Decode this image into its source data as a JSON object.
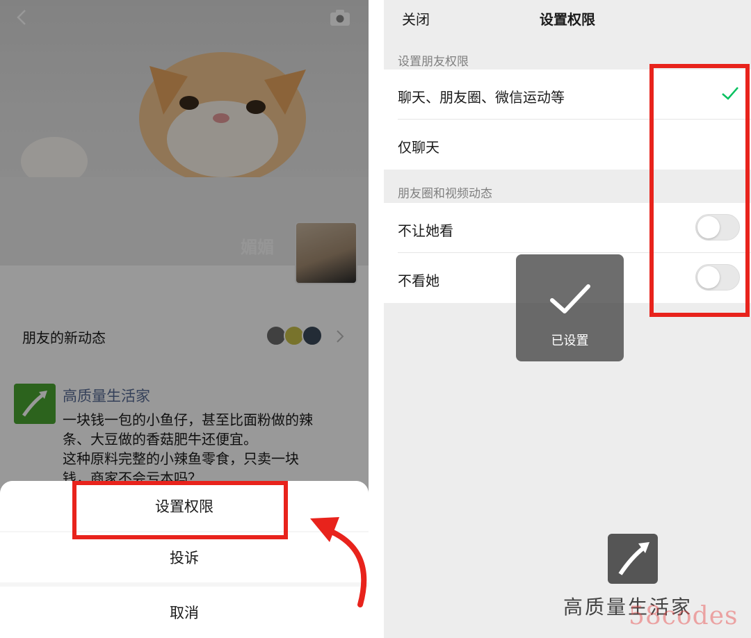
{
  "left": {
    "cover": {
      "name": "媚媚"
    },
    "feed": {
      "label": "朋友的新动态"
    },
    "post": {
      "author": "高质量生活家",
      "text": "一块钱一包的小鱼仔，甚至比面粉做的辣\n条、大豆做的香菇肥牛还便宜。\n这种原料完整的小辣鱼零食，只卖一块\n钱，商家不会亏本吗？"
    },
    "action_sheet": {
      "set_permission": "设置权限",
      "report": "投诉",
      "cancel": "取消"
    }
  },
  "right": {
    "nav": {
      "close": "关闭",
      "title": "设置权限"
    },
    "section_friend_permission": {
      "label": "设置朋友权限",
      "options": [
        "聊天、朋友圈、微信运动等",
        "仅聊天"
      ],
      "selected_index": 0
    },
    "section_moments": {
      "label": "朋友圈和视频动态",
      "toggles": [
        {
          "label": "不让她看",
          "on": false
        },
        {
          "label": "不看她",
          "on": false
        }
      ]
    },
    "toast": {
      "text": "已设置"
    },
    "watermark": {
      "name": "高质量生活家",
      "brand": "58codes"
    }
  },
  "colors": {
    "accent_green": "#07c160",
    "highlight_red": "#e8231c",
    "link_blue": "#576b95"
  },
  "icons": [
    "back-icon",
    "camera-icon",
    "chevron-right-icon",
    "check-icon",
    "toast-check-icon",
    "red-arrow-icon"
  ]
}
